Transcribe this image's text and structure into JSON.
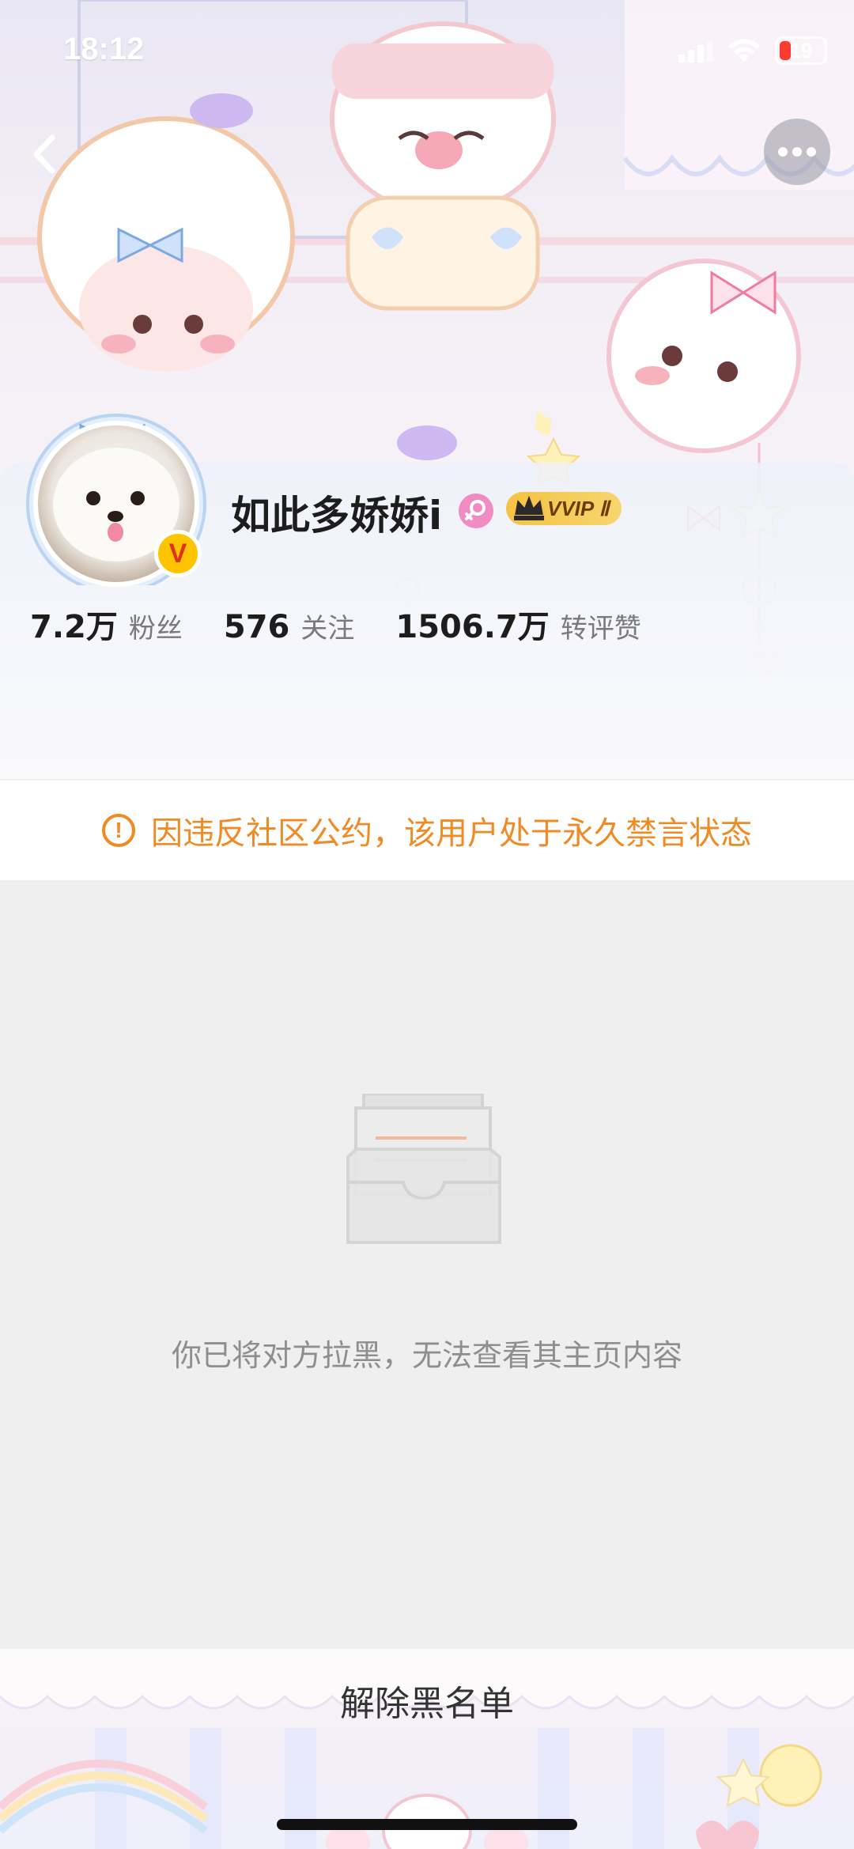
{
  "status_bar": {
    "time": "18:12",
    "battery": "19",
    "signal_icon": "cellular-signal-icon",
    "wifi_icon": "wifi-icon"
  },
  "nav": {
    "back_icon": "chevron-left-icon",
    "more_icon": "more-dots-icon"
  },
  "profile": {
    "username": "如此多娇娇i",
    "gender_icon": "female-icon",
    "vip_label": "VVIP Ⅱ",
    "verified_badge": "V",
    "stats": [
      {
        "value": "7.2万",
        "label": "粉丝"
      },
      {
        "value": "576",
        "label": "关注"
      },
      {
        "value": "1506.7万",
        "label": "转评赞"
      }
    ]
  },
  "notice": {
    "icon": "!",
    "text": "因违反社区公约，该用户处于永久禁言状态",
    "color": "#f08a23"
  },
  "empty_state": {
    "illustration_icon": "empty-inbox-icon",
    "message": "你已将对方拉黑，无法查看其主页内容"
  },
  "bottom": {
    "unblock_label": "解除黑名单"
  }
}
